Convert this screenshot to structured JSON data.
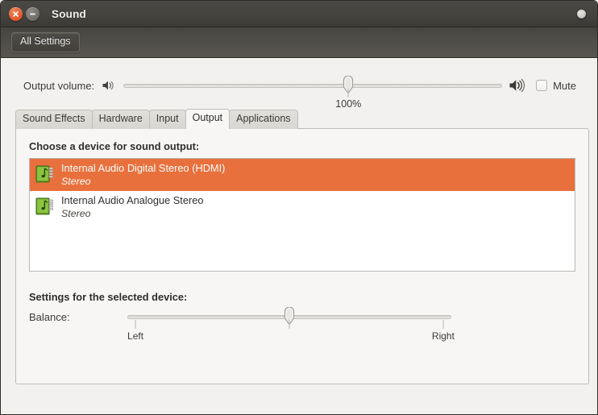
{
  "window": {
    "title": "Sound",
    "close_icon": "close-icon",
    "minimize_icon": "minimize-icon",
    "indicator_icon": "window-indicator-icon"
  },
  "toolbar": {
    "all_settings_label": "All Settings"
  },
  "volume": {
    "label": "Output volume:",
    "low_icon": "speaker-low-icon",
    "high_icon": "speaker-high-icon",
    "value_label": "100%",
    "value_percent": 59.4,
    "mute_label": "Mute",
    "mute_checked": false
  },
  "tabs": [
    {
      "label": "Sound Effects",
      "active": false
    },
    {
      "label": "Hardware",
      "active": false
    },
    {
      "label": "Input",
      "active": false
    },
    {
      "label": "Output",
      "active": true
    },
    {
      "label": "Applications",
      "active": false
    }
  ],
  "output_panel": {
    "device_section_title": "Choose a device for sound output:",
    "devices": [
      {
        "name": "Internal Audio Digital Stereo (HDMI)",
        "profile": "Stereo",
        "icon": "audio-card-icon",
        "selected": true
      },
      {
        "name": "Internal Audio Analogue Stereo",
        "profile": "Stereo",
        "icon": "audio-card-icon",
        "selected": false
      }
    ],
    "settings_title": "Settings for the selected device:",
    "balance_label": "Balance:",
    "balance_left_label": "Left",
    "balance_right_label": "Right",
    "balance_percent": 50
  },
  "colors": {
    "selection_orange": "#e8703c",
    "titlebar_dark": "#44423d",
    "window_background": "#f2f1f0",
    "panel_background": "#f7f6f5",
    "close_button_orange": "#e2562a"
  }
}
